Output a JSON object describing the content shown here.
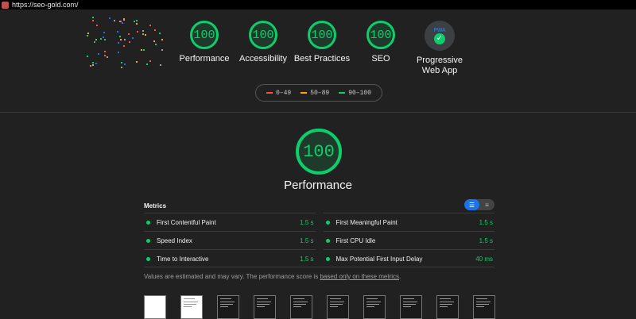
{
  "url": "https://seo-gold.com/",
  "colors": {
    "pass": "#0cce6b",
    "average": "#ffa400",
    "fail": "#ff4e42"
  },
  "categories": [
    {
      "label": "Performance",
      "score": "100"
    },
    {
      "label": "Accessibility",
      "score": "100"
    },
    {
      "label": "Best Practices",
      "score": "100"
    },
    {
      "label": "SEO",
      "score": "100"
    }
  ],
  "pwa": {
    "line1": "Progressive",
    "line2": "Web App",
    "badge": "PWA"
  },
  "legend": [
    {
      "range": "0–49",
      "color": "#ff4e42"
    },
    {
      "range": "50–89",
      "color": "#ffa400"
    },
    {
      "range": "90–100",
      "color": "#0cce6b"
    }
  ],
  "main": {
    "score": "100",
    "title": "Performance"
  },
  "metrics_title": "Metrics",
  "metrics": [
    {
      "name": "First Contentful Paint",
      "value": "1.5 s"
    },
    {
      "name": "First Meaningful Paint",
      "value": "1.5 s"
    },
    {
      "name": "Speed Index",
      "value": "1.5 s"
    },
    {
      "name": "First CPU Idle",
      "value": "1.5 s"
    },
    {
      "name": "Time to Interactive",
      "value": "1.5 s"
    },
    {
      "name": "Max Potential First Input Delay",
      "value": "40 ms"
    }
  ],
  "note": {
    "before": "Values are estimated and may vary. The performance score is ",
    "link": "based only on these metrics",
    "after": "."
  },
  "filmstrip_count": 10
}
